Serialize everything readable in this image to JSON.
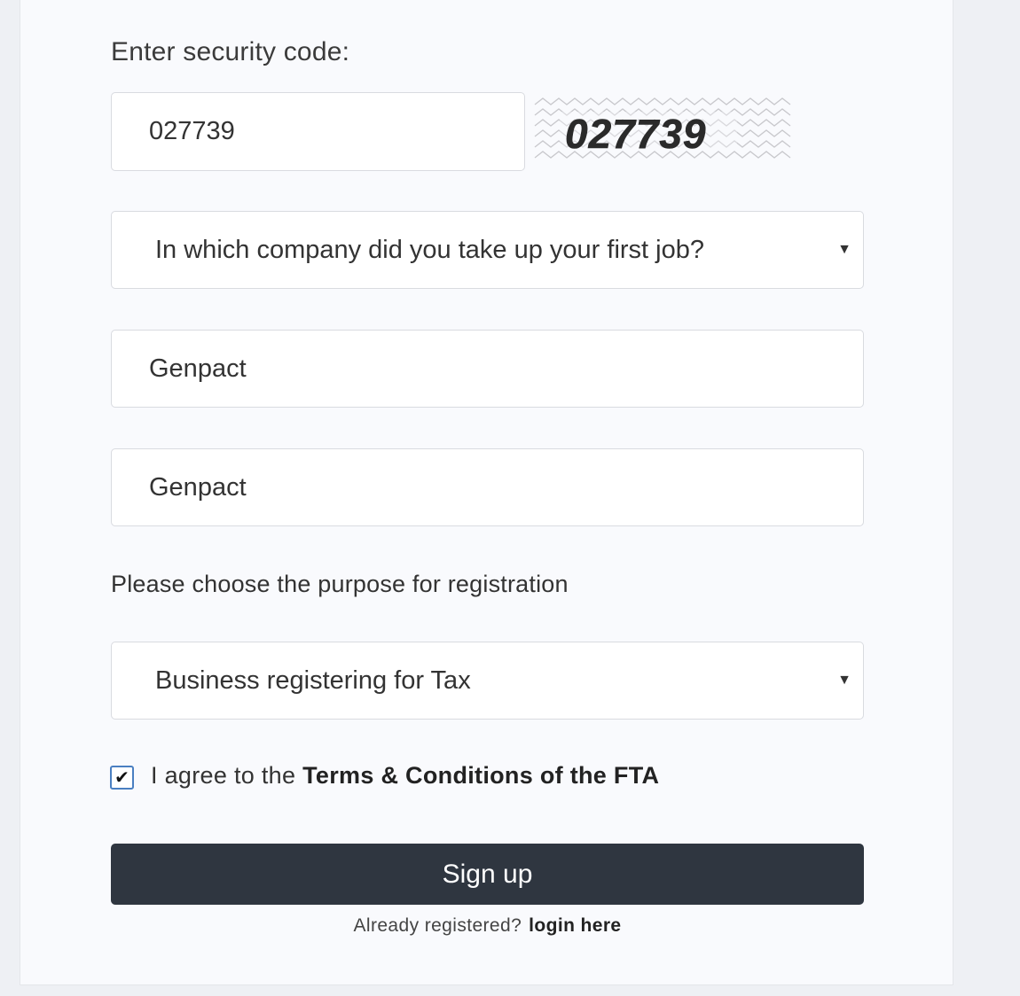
{
  "security": {
    "label": "Enter security code:",
    "input_value": "027739",
    "captcha_text": "027739"
  },
  "question": {
    "selected": "In which company did you take up your first job?"
  },
  "answer": {
    "value": "Genpact",
    "confirm_value": "Genpact"
  },
  "purpose": {
    "label": "Please choose the purpose for registration",
    "selected": "Business registering for Tax"
  },
  "terms": {
    "checked": true,
    "prefix": "I agree to the ",
    "link": "Terms & Conditions of the FTA"
  },
  "signup": {
    "label": "Sign up"
  },
  "login": {
    "prefix": "Already registered?",
    "link": "login here"
  },
  "icons": {
    "caret": "caret-down-icon",
    "check": "checkmark-icon"
  }
}
